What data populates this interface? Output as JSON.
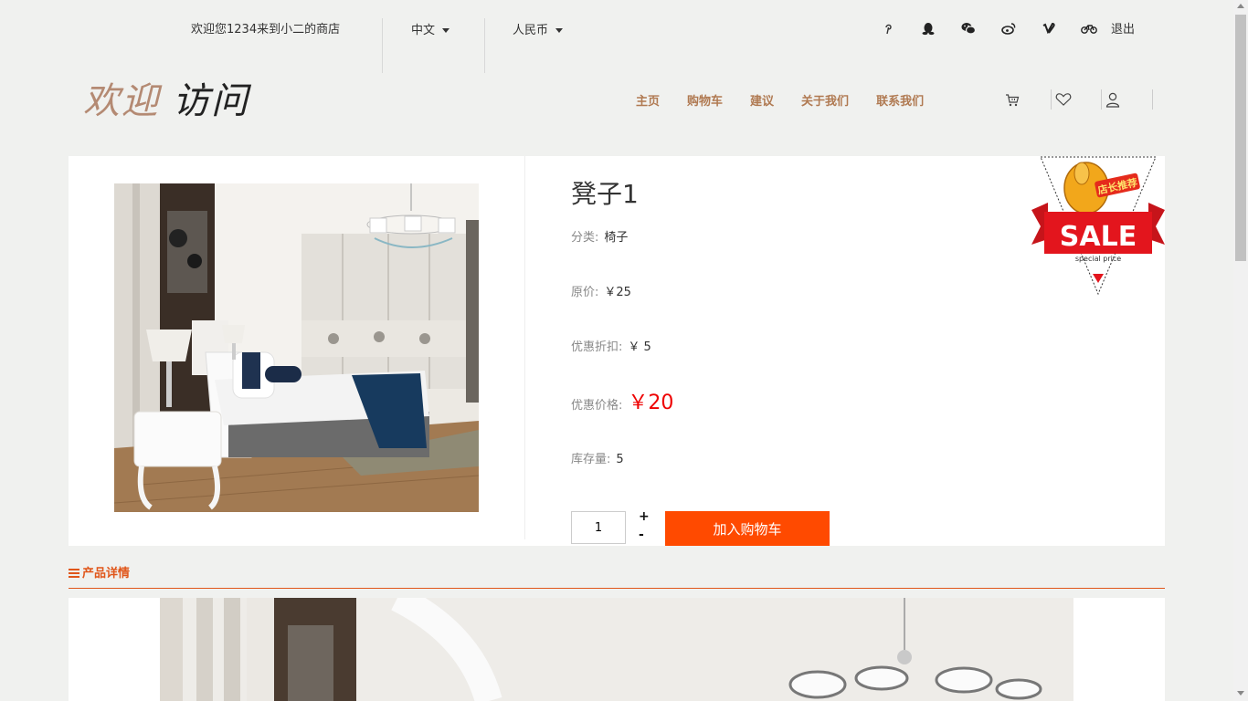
{
  "topbar": {
    "welcome": "欢迎您1234来到小二的商店",
    "language": "中文",
    "currency": "人民币",
    "social_icons": [
      "pinterest-icon",
      "qq-icon",
      "wechat-icon",
      "weibo-icon",
      "vimeo-icon",
      "bicycle-icon"
    ],
    "logout": "退出"
  },
  "logo": {
    "part1": "欢迎",
    "part2": "访问"
  },
  "nav": {
    "items": [
      "主页",
      "购物车",
      "建议",
      "关于我们",
      "联系我们"
    ]
  },
  "header_icons": [
    "cart-icon",
    "heart-icon",
    "user-icon"
  ],
  "product": {
    "name": "凳子1",
    "category_label": "分类:",
    "category": "椅子",
    "original_label": "原价:",
    "original_price": "￥25",
    "discount_label": "优惠折扣:",
    "discount": "￥ 5",
    "sale_label": "优惠价格:",
    "sale_price": "￥20",
    "stock_label": "库存量:",
    "stock": "5",
    "quantity": "1",
    "plus": "+",
    "minus": "-",
    "add_to_cart": "加入购物车"
  },
  "badge": {
    "text": "SALE",
    "top_text": "店长推荐",
    "sub_text": "special price"
  },
  "details": {
    "title": "产品详情"
  },
  "colors": {
    "accent": "#ff4a00",
    "price": "#e00000",
    "nav": "#b07a52",
    "logo": "#b48a73"
  }
}
